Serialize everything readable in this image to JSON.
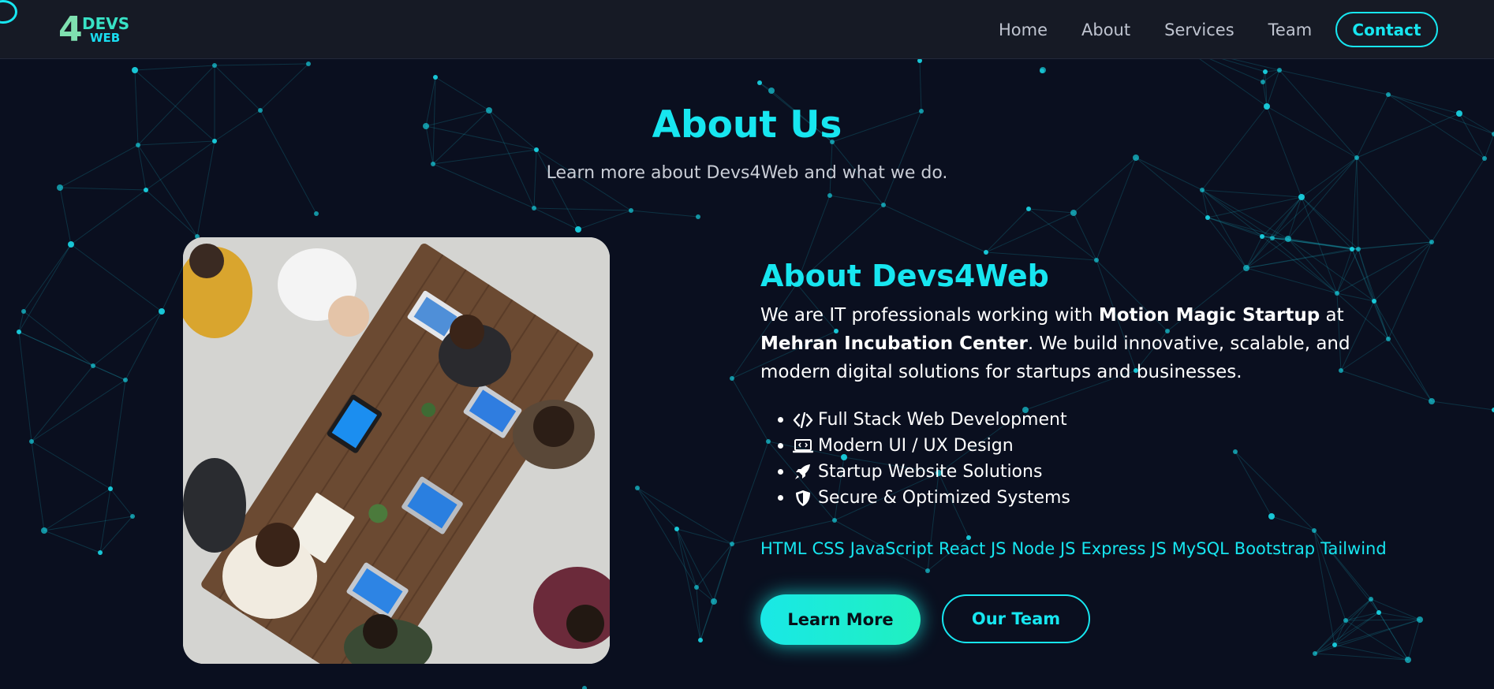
{
  "nav": {
    "logo_number": "4",
    "logo_line1": "DEVS",
    "logo_line2": "WEB",
    "links": [
      "Home",
      "About",
      "Services",
      "Team"
    ],
    "contact_label": "Contact"
  },
  "hero": {
    "title": "About Us",
    "subtitle": "Learn more about Devs4Web and what we do."
  },
  "about": {
    "heading": "About Devs4Web",
    "text_1": "We are IT professionals working with ",
    "bold_1": "Motion Magic Startup",
    "text_2": " at ",
    "bold_2": "Mehran Incubation Center",
    "text_3": ". We build innovative, scalable, and modern digital solutions for startups and businesses.",
    "features": [
      {
        "icon": "code-icon",
        "label": "Full Stack Web Development"
      },
      {
        "icon": "laptop-code-icon",
        "label": "Modern UI / UX Design"
      },
      {
        "icon": "rocket-icon",
        "label": "Startup Website Solutions"
      },
      {
        "icon": "shield-icon",
        "label": "Secure & Optimized Systems"
      }
    ],
    "tech": [
      "HTML",
      "CSS",
      "JavaScript",
      "React JS",
      "Node JS",
      "Express JS",
      "MySQL",
      "Bootstrap",
      "Tailwind"
    ]
  },
  "actions": {
    "learn_more": "Learn More",
    "our_team": "Our Team"
  },
  "colors": {
    "accent": "#17e6f0",
    "background": "#0a0f1f",
    "navbar": "#161a25"
  }
}
